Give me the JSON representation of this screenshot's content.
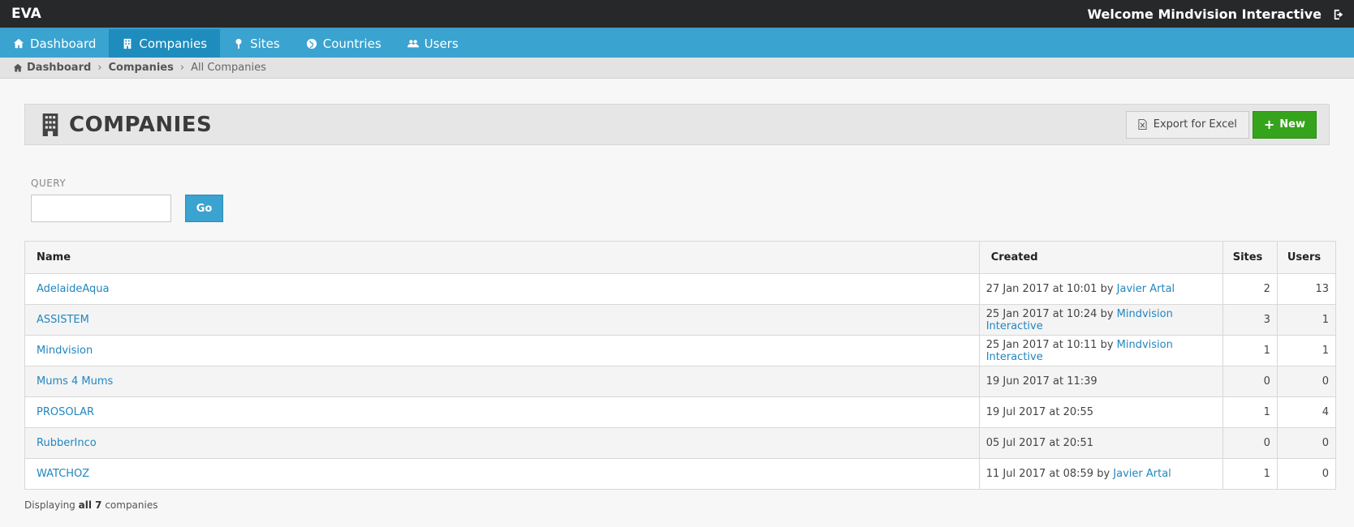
{
  "topbar": {
    "brand": "EVA",
    "welcome": "Welcome Mindvision Interactive"
  },
  "nav": [
    {
      "label": "Dashboard",
      "icon": "home-icon"
    },
    {
      "label": "Companies",
      "icon": "building-icon"
    },
    {
      "label": "Sites",
      "icon": "map-pin-icon"
    },
    {
      "label": "Countries",
      "icon": "globe-icon"
    },
    {
      "label": "Users",
      "icon": "users-icon"
    }
  ],
  "breadcrumb": {
    "home": "Dashboard",
    "section": "Companies",
    "current": "All Companies"
  },
  "page": {
    "title": "COMPANIES",
    "export_label": "Export for Excel",
    "new_label": "New"
  },
  "query": {
    "label": "QUERY",
    "value": "",
    "go_label": "Go"
  },
  "table": {
    "headers": {
      "name": "Name",
      "created": "Created",
      "sites": "Sites",
      "users": "Users"
    },
    "rows": [
      {
        "name": "AdelaideAqua",
        "created": "27 Jan 2017 at 10:01",
        "by": "Javier Artal",
        "sites": "2",
        "users": "13"
      },
      {
        "name": "ASSISTEM",
        "created": "25 Jan 2017 at 10:24",
        "by": "Mindvision Interactive",
        "sites": "3",
        "users": "1"
      },
      {
        "name": "Mindvision",
        "created": "25 Jan 2017 at 10:11",
        "by": "Mindvision Interactive",
        "sites": "1",
        "users": "1"
      },
      {
        "name": "Mums 4 Mums",
        "created": "19 Jun 2017 at 11:39",
        "by": "",
        "sites": "0",
        "users": "0"
      },
      {
        "name": "PROSOLAR",
        "created": "19 Jul 2017 at 20:55",
        "by": "",
        "sites": "1",
        "users": "4"
      },
      {
        "name": "RubberInco",
        "created": "05 Jul 2017 at 20:51",
        "by": "",
        "sites": "0",
        "users": "0"
      },
      {
        "name": "WATCHOZ",
        "created": "11 Jul 2017 at 08:59",
        "by": "Javier Artal",
        "sites": "1",
        "users": "0"
      }
    ]
  },
  "footer": {
    "prefix": "Displaying",
    "count": "all 7",
    "suffix": "companies"
  },
  "colors": {
    "topbar": "#262829",
    "nav": "#3aa3d0",
    "nav_active": "#1f8cbe",
    "link": "#2187c0",
    "new_button": "#36a31c"
  }
}
